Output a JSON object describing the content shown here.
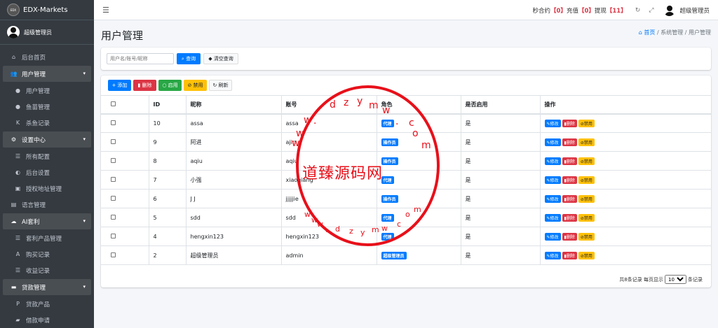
{
  "brand": {
    "name": "EDX-Markets",
    "logo_text": "EDX"
  },
  "user": {
    "name": "超级管理员"
  },
  "sidebar": {
    "items": [
      {
        "label": "后台首页",
        "icon": "home-icon",
        "glyph": "⌂",
        "type": "item"
      },
      {
        "label": "用户管理",
        "icon": "users-icon",
        "glyph": "👥",
        "type": "group"
      },
      {
        "label": "用户管理",
        "icon": "user-icon",
        "glyph": "●",
        "type": "sub"
      },
      {
        "label": "鱼苗管理",
        "icon": "users-icon",
        "glyph": "●",
        "type": "sub"
      },
      {
        "label": "杀鱼记录",
        "icon": "k-icon",
        "glyph": "K",
        "type": "sub"
      },
      {
        "label": "设置中心",
        "icon": "gears-icon",
        "glyph": "⚙",
        "type": "group"
      },
      {
        "label": "所有配置",
        "icon": "list-icon",
        "glyph": "☰",
        "type": "sub"
      },
      {
        "label": "后台设置",
        "icon": "half-circle-icon",
        "glyph": "◐",
        "type": "sub"
      },
      {
        "label": "授权地址管理",
        "icon": "document-icon",
        "glyph": "▣",
        "type": "sub"
      },
      {
        "label": "语言管理",
        "icon": "language-icon",
        "glyph": "▤",
        "type": "item"
      },
      {
        "label": "AI套利",
        "icon": "cloud-icon",
        "glyph": "☁",
        "type": "group"
      },
      {
        "label": "套利产品管理",
        "icon": "list-icon",
        "glyph": "☰",
        "type": "sub"
      },
      {
        "label": "购买记录",
        "icon": "a-icon",
        "glyph": "A",
        "type": "sub"
      },
      {
        "label": "收益记录",
        "icon": "list-icon",
        "glyph": "☰",
        "type": "sub"
      },
      {
        "label": "贷款管理",
        "icon": "money-icon",
        "glyph": "▬",
        "type": "group"
      },
      {
        "label": "贷款产品",
        "icon": "p-icon",
        "glyph": "P",
        "type": "sub"
      },
      {
        "label": "借款申请",
        "icon": "truck-icon",
        "glyph": "▰",
        "type": "sub"
      }
    ]
  },
  "topbar": {
    "seconds_label": "秒合约",
    "seconds_count": "【0】",
    "recharge_label": "充值",
    "recharge_count": "【0】",
    "withdraw_label": "提现",
    "withdraw_count": "【11】",
    "refresh_icon": "↻",
    "expand_icon": "⤢",
    "user_name": "超级管理员"
  },
  "page": {
    "title": "用户管理",
    "breadcrumb": [
      "首页",
      "系统管理",
      "用户管理"
    ],
    "breadcrumb_sep": "/"
  },
  "search": {
    "placeholder": "用户名/账号/昵称",
    "query_label": "查询",
    "clear_label": "清空查询"
  },
  "toolbar": {
    "add_label": "添加",
    "delete_label": "删除",
    "enable_label": "启用",
    "disable_label": "禁用",
    "refresh_label": "刷新"
  },
  "table": {
    "columns": [
      "",
      "ID",
      "昵称",
      "账号",
      "角色",
      "是否启用",
      "操作"
    ],
    "rows": [
      {
        "id": "10",
        "nickname": "assa",
        "account": "assa",
        "role": "代理",
        "enabled": "是"
      },
      {
        "id": "9",
        "nickname": "阿进",
        "account": "ajin",
        "role": "操作员",
        "enabled": "是"
      },
      {
        "id": "8",
        "nickname": "aqiu",
        "account": "aqiu",
        "role": "操作员",
        "enabled": "是"
      },
      {
        "id": "7",
        "nickname": "小强",
        "account": "xiaoqiang",
        "role": "代理",
        "enabled": "是"
      },
      {
        "id": "6",
        "nickname": "J J",
        "account": "jjjjjie",
        "role": "操作员",
        "enabled": "是"
      },
      {
        "id": "5",
        "nickname": "sdd",
        "account": "sdd",
        "role": "代理",
        "enabled": "是"
      },
      {
        "id": "4",
        "nickname": "hengxin123",
        "account": "hengxin123",
        "role": "代理",
        "enabled": "是"
      },
      {
        "id": "2",
        "nickname": "超级管理员",
        "account": "admin",
        "role": "超级管理员",
        "enabled": "是"
      }
    ],
    "row_actions": {
      "edit": "修改",
      "delete": "删除",
      "disable": "禁用"
    }
  },
  "pagination": {
    "summary": "共8条记录",
    "per_page_prefix": "每页显示",
    "per_page_value": "10",
    "per_page_suffix": "条记录"
  },
  "watermark": {
    "center_text": "道臻源码网",
    "letters_top": [
      "w",
      "w",
      "w",
      ".",
      "d",
      "z",
      "y",
      "m",
      "w",
      ".",
      "c",
      "o",
      "m"
    ],
    "letters_bottom": [
      "w",
      "w",
      "w",
      ".",
      "d",
      "z",
      "y",
      "m",
      "w",
      ".",
      "c",
      "o",
      "m"
    ],
    "color": "#e8101a"
  },
  "colors": {
    "primary": "#007bff",
    "danger": "#dc3545",
    "success": "#28a745",
    "warning": "#ffc107",
    "sidebar": "#343a40"
  }
}
